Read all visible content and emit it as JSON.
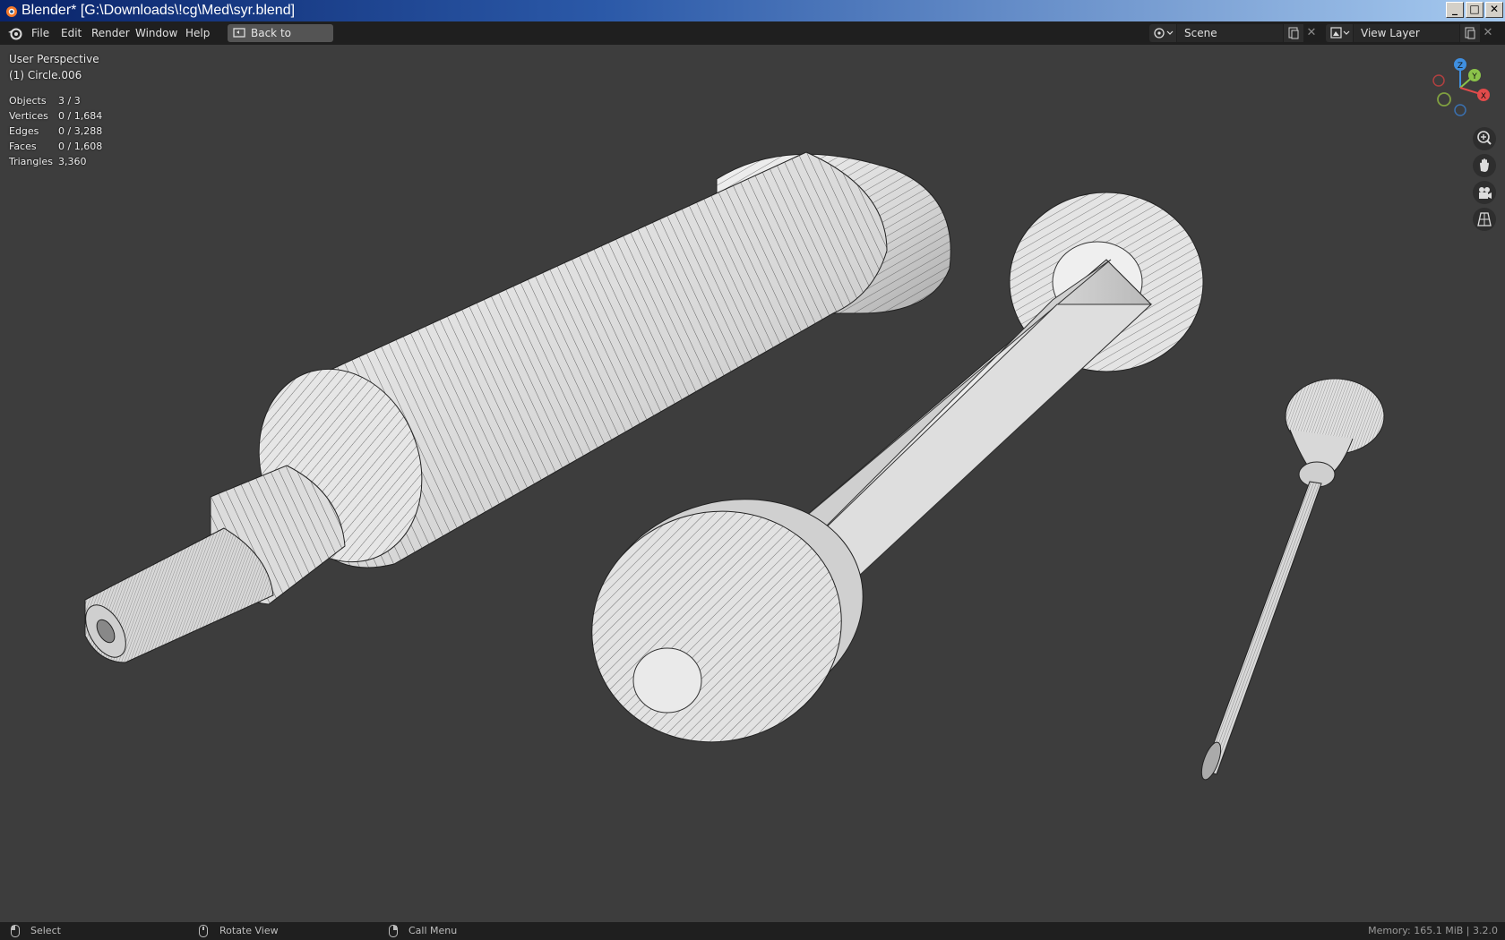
{
  "window": {
    "title": "Blender* [G:\\Downloads\\!cg\\Med\\syr.blend]",
    "minimize": "_",
    "maximize": "□",
    "close": "✕"
  },
  "menu": {
    "items": [
      "File",
      "Edit",
      "Render",
      "Window",
      "Help"
    ],
    "back_button": "Back to Previous"
  },
  "scene": {
    "label": "Scene",
    "close": "✕"
  },
  "view_layer": {
    "label": "View Layer",
    "close": "✕"
  },
  "viewport": {
    "perspective": "User Perspective",
    "active_object": "(1) Circle.006",
    "stats": [
      {
        "label": "Objects",
        "value": "3 / 3"
      },
      {
        "label": "Vertices",
        "value": "0 / 1,684"
      },
      {
        "label": "Edges",
        "value": "0 / 3,288"
      },
      {
        "label": "Faces",
        "value": "0 / 1,608"
      },
      {
        "label": "Triangles",
        "value": "3,360"
      }
    ],
    "gizmo": {
      "x": "X",
      "y": "Y",
      "z": "Z"
    },
    "nav_icons": [
      "zoom-icon",
      "hand-pan-icon",
      "camera-icon",
      "grid-ortho-icon"
    ]
  },
  "statusbar": {
    "select": "Select",
    "rotate": "Rotate View",
    "call_menu": "Call Menu",
    "memory": "Memory: 165.1 MiB | 3.2.0"
  },
  "colors": {
    "viewport_bg": "#3d3d3d",
    "header_bg": "#1f1f1f",
    "gizmo_x": "#e14b4b",
    "gizmo_y": "#8bc34a",
    "gizmo_z": "#3f8fe0",
    "mesh_fill": "#d9d9d9",
    "wire": "#1a1a1a"
  }
}
